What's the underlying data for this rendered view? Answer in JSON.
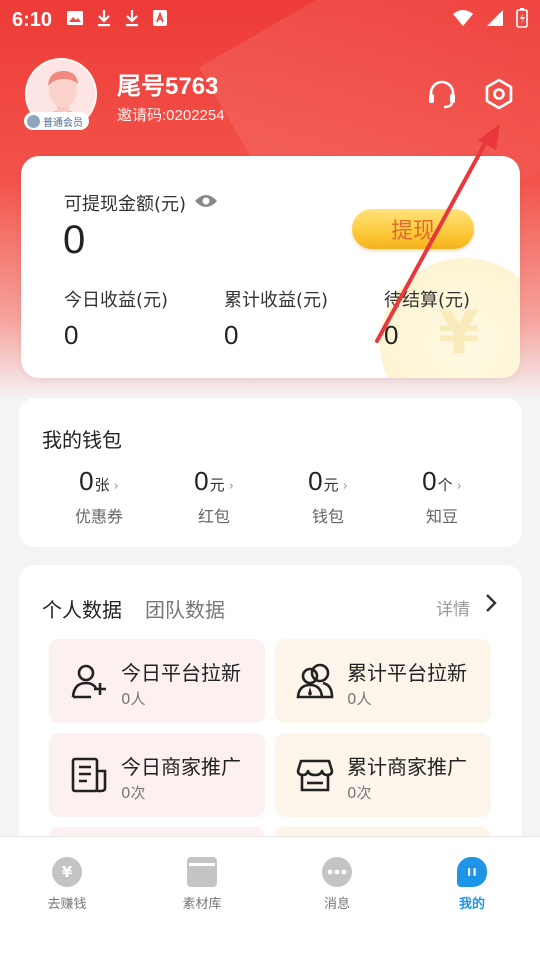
{
  "status_bar": {
    "time": "6:10"
  },
  "profile": {
    "name": "尾号5763",
    "invite_code": "邀请码:0202254",
    "member_level": "普通会员"
  },
  "earnings": {
    "withdrawable_label": "可提现金额(元)",
    "withdrawable_amount": "0",
    "withdraw_button": "提现",
    "stats": [
      {
        "label": "今日收益(元)",
        "value": "0"
      },
      {
        "label": "累计收益(元)",
        "value": "0"
      },
      {
        "label": "待结算(元)",
        "value": "0"
      }
    ]
  },
  "wallet": {
    "title": "我的钱包",
    "items": [
      {
        "value": "0",
        "unit": "张",
        "label": "优惠券"
      },
      {
        "value": "0",
        "unit": "元",
        "label": "红包"
      },
      {
        "value": "0",
        "unit": "元",
        "label": "钱包"
      },
      {
        "value": "0",
        "unit": "个",
        "label": "知豆"
      }
    ]
  },
  "data_panel": {
    "tabs": [
      "个人数据",
      "团队数据"
    ],
    "details_label": "详情",
    "tiles": [
      {
        "title": "今日平台拉新",
        "value": "0人",
        "icon": "add-user-icon"
      },
      {
        "title": "累计平台拉新",
        "value": "0人",
        "icon": "users-group-icon"
      },
      {
        "title": "今日商家推广",
        "value": "0次",
        "icon": "document-icon"
      },
      {
        "title": "累计商家推广",
        "value": "0次",
        "icon": "store-icon"
      }
    ]
  },
  "bottom_nav": {
    "items": [
      {
        "label": "去赚钱",
        "icon": "yen-coin-icon"
      },
      {
        "label": "素材库",
        "icon": "library-icon"
      },
      {
        "label": "消息",
        "icon": "message-icon"
      },
      {
        "label": "我的",
        "icon": "profile-icon",
        "active": true
      }
    ]
  },
  "colors": {
    "brand_red": "#ee3b37",
    "withdraw_button": "#fbc531",
    "active_tab": "#1f95e8",
    "annotation_arrow": "#e8383d"
  }
}
